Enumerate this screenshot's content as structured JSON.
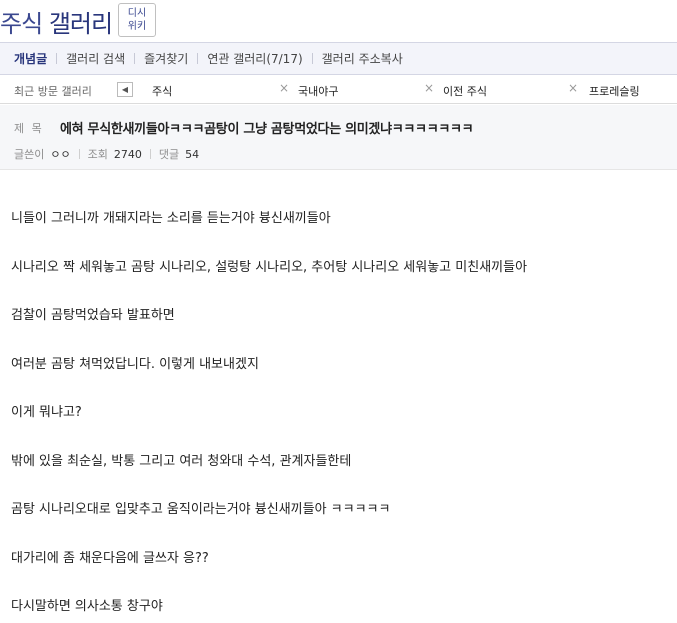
{
  "header": {
    "gallery_title_part1": "주식",
    "gallery_title_part2": "갤러리",
    "wiki_line1": "디시",
    "wiki_line2": "위키"
  },
  "menu": {
    "items": [
      "개념글",
      "갤러리 검색",
      "즐겨찾기",
      "연관 갤러리(7/17)",
      "갤러리 주소복사"
    ]
  },
  "recent": {
    "label": "최근 방문 갤러리",
    "prev_icon": "chevron-left-icon",
    "items": [
      "주식",
      "국내야구",
      "이전 주식",
      "프로레슬링"
    ]
  },
  "post": {
    "subject_label": "제 목",
    "subject": "에혀 무식한새끼들아ㅋㅋㅋ곰탕이 그냥 곰탕먹었다는 의미겠냐ㅋㅋㅋㅋㅋㅋㅋ",
    "author_label": "글쓴이",
    "author": "ㅇㅇ",
    "views_label": "조회",
    "views": "2740",
    "comments_label": "댓글",
    "comments": "54"
  },
  "body": {
    "paragraphs": [
      "니들이 그러니까 개돼지라는 소리를 듣는거야 븅신새끼들아",
      "시나리오 짝 세워놓고 곰탕 시나리오, 설렁탕 시나리오, 추어탕 시나리오 세워놓고 미친새끼들아",
      "검찰이 곰탕먹었습돠 발표하면",
      "여러분 곰탕 쳐먹었답니다. 이렇게 내보내겠지",
      "이게 뭐냐고?",
      "밖에 있을 최순실, 박통 그리고 여러 청와대 수석, 관계자들한테",
      "곰탕 시나리오대로 입맞추고 움직이라는거야 븅신새끼들아 ㅋㅋㅋㅋㅋ",
      "대가리에 좀 채운다음에 글쓰자 응??",
      "다시말하면 의사소통 창구야"
    ]
  }
}
